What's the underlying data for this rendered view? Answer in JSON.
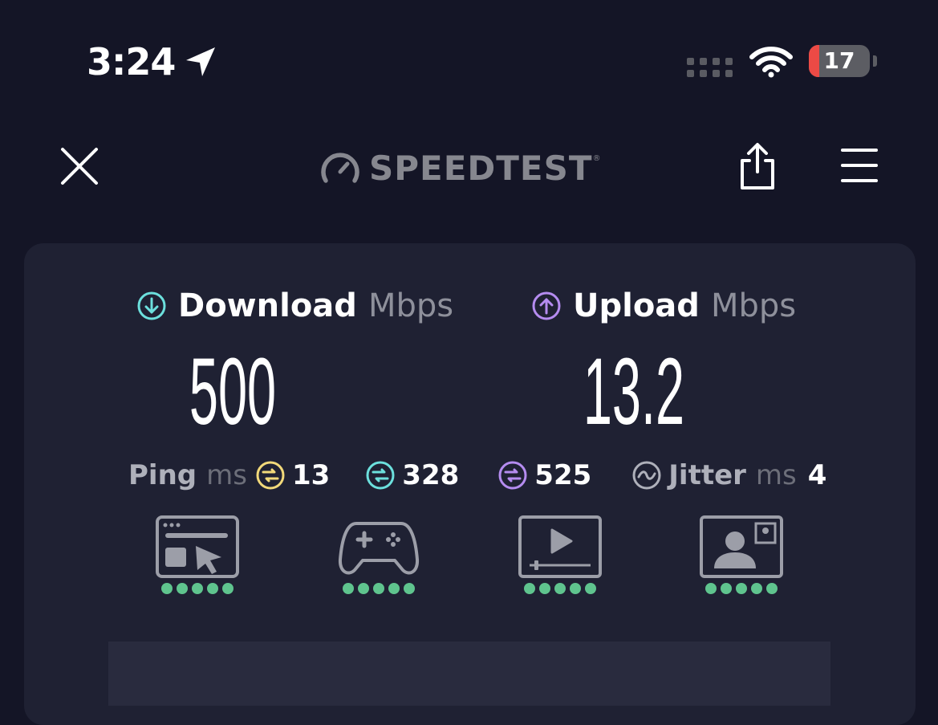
{
  "status_bar": {
    "time": "3:24",
    "location_icon": "location-arrow-icon",
    "signal_icon": "cellular-signal-icon",
    "wifi_icon": "wifi-icon",
    "battery_level": "17",
    "battery_percent": 17,
    "battery_color": "#ec4a45"
  },
  "nav": {
    "close_icon": "close-icon",
    "logo_text": "SPEEDTEST",
    "logo_trademark": "®",
    "share_icon": "share-icon",
    "menu_icon": "hamburger-menu-icon"
  },
  "results": {
    "download": {
      "label": "Download",
      "unit": "Mbps",
      "value": "500",
      "color": "#6ce0dd"
    },
    "upload": {
      "label": "Upload",
      "unit": "Mbps",
      "value": "13.2",
      "color": "#b58cf0"
    },
    "ping": {
      "label": "Ping",
      "unit": "ms",
      "idle": "13",
      "download": "328",
      "upload": "525",
      "idle_color": "#f2d97a",
      "download_color": "#6ce0dd",
      "upload_color": "#b58cf0"
    },
    "jitter": {
      "label": "Jitter",
      "unit": "ms",
      "value": "4"
    }
  },
  "experience": [
    {
      "icon": "web-browsing-icon",
      "rating": 5,
      "max": 5
    },
    {
      "icon": "gaming-controller-icon",
      "rating": 5,
      "max": 5
    },
    {
      "icon": "video-streaming-icon",
      "rating": 5,
      "max": 5
    },
    {
      "icon": "video-call-icon",
      "rating": 5,
      "max": 5
    }
  ],
  "colors": {
    "background": "#141526",
    "card": "#1f2133",
    "rating_dot": "#5fc48e"
  }
}
